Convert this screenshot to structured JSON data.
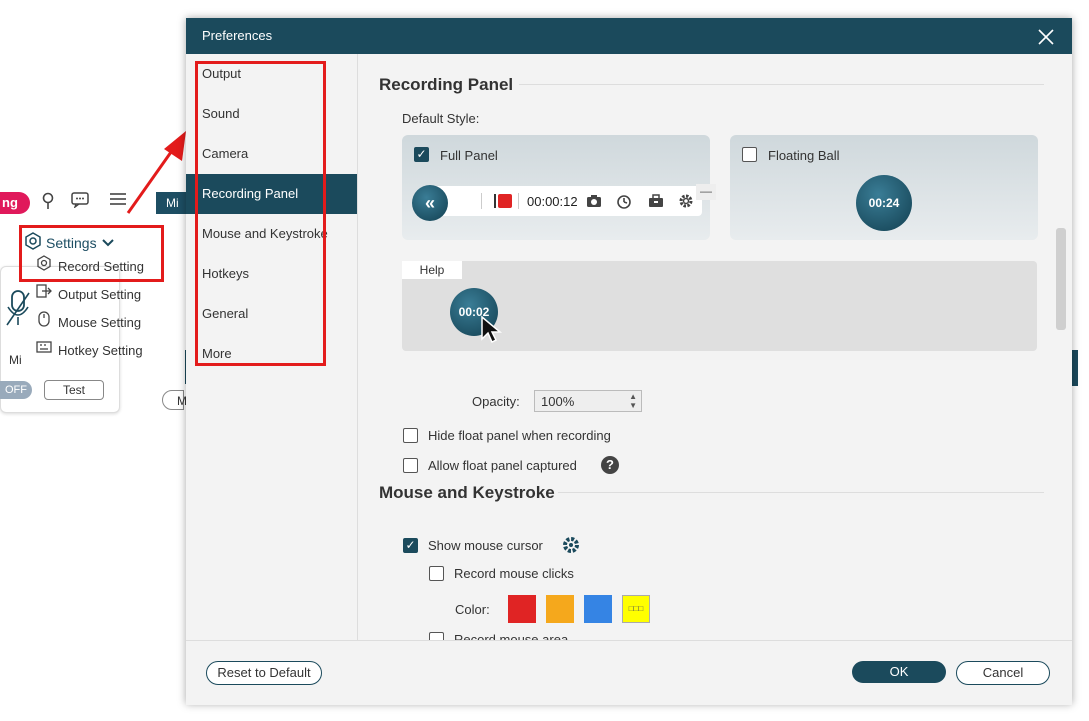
{
  "bg_app": {
    "record_badge": "ng",
    "mini_label": "Mi",
    "settings_label": "Settings",
    "menu": [
      "Record Setting",
      "Output Setting",
      "Mouse Setting",
      "Hotkey Setting"
    ],
    "mic_label": "Mi",
    "off_label": "OFF",
    "test_label": "Test",
    "m_label": "M"
  },
  "dialog": {
    "title": "Preferences",
    "nav": [
      "Output",
      "Sound",
      "Camera",
      "Recording Panel",
      "Mouse and Keystroke",
      "Hotkeys",
      "General",
      "More"
    ],
    "active_nav": "Recording Panel",
    "recording_panel": {
      "heading": "Recording Panel",
      "default_style_label": "Default Style:",
      "full_panel_label": "Full Panel",
      "full_panel_checked": true,
      "floating_ball_label": "Floating Ball",
      "floating_ball_checked": false,
      "panel_time": "00:00:12",
      "ball_time": "00:24",
      "help_label": "Help",
      "help_ball_time": "00:02",
      "opacity_label": "Opacity:",
      "opacity_value": "100%",
      "hide_float_label": "Hide float panel when recording",
      "allow_captured_label": "Allow float panel captured"
    },
    "mouse_keystroke": {
      "heading": "Mouse and Keystroke",
      "show_cursor_label": "Show mouse cursor",
      "show_cursor_checked": true,
      "record_clicks_label": "Record mouse clicks",
      "color_label": "Color:",
      "colors": [
        "#e02424",
        "#f5a81c",
        "#3584e4",
        "#ffff00"
      ],
      "record_area_label": "Record mouse area"
    },
    "footer": {
      "reset_label": "Reset to Default",
      "ok_label": "OK",
      "cancel_label": "Cancel"
    }
  },
  "colors": {
    "accent": "#1b4a5c",
    "highlight_box": "#e31b1b",
    "record_pill": "#e0195b"
  }
}
